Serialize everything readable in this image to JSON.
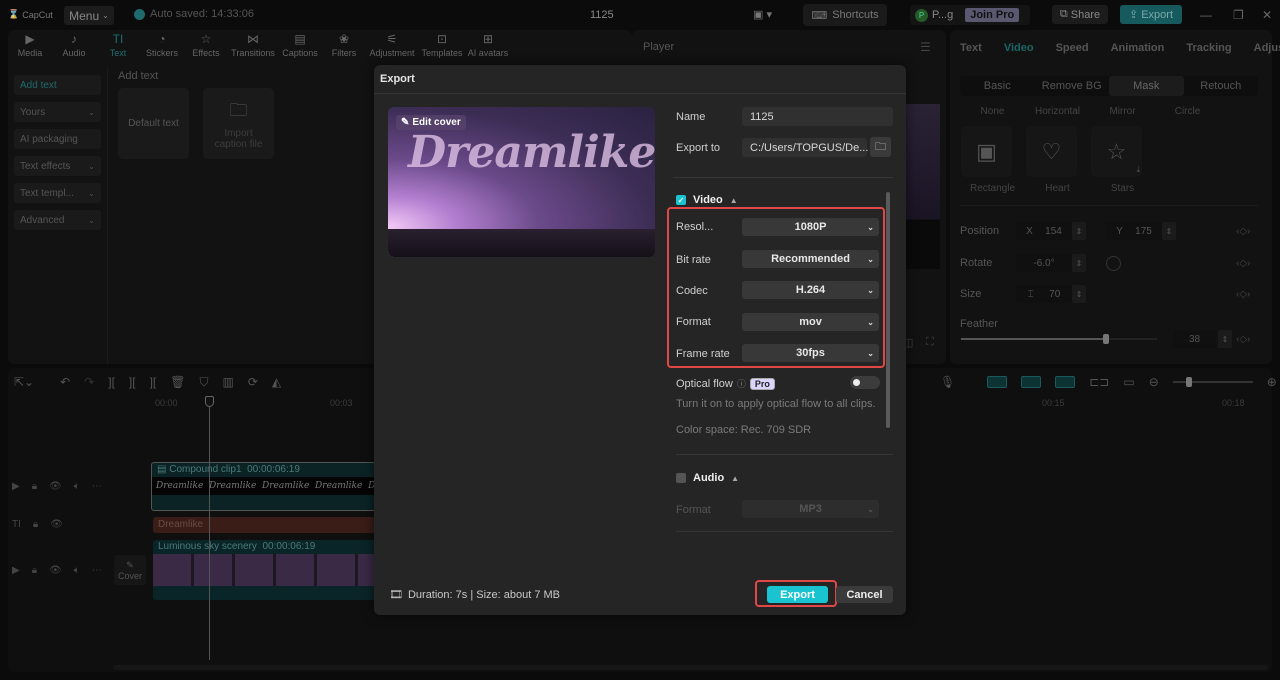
{
  "app": {
    "logo": "CapCut",
    "menu_label": "Menu",
    "autosave": "Auto saved: 14:33:06",
    "project_title": "1125",
    "shortcuts_label": "Shortcuts",
    "user_initial": "P",
    "user_name": "P...g",
    "join_pro": "Join Pro",
    "share_label": "Share",
    "export_label": "Export"
  },
  "toolbar": {
    "tools": [
      {
        "label": "Media",
        "icon": "media-icon"
      },
      {
        "label": "Audio",
        "icon": "audio-icon"
      },
      {
        "label": "Text",
        "icon": "text-icon",
        "active": true
      },
      {
        "label": "Stickers",
        "icon": "stickers-icon"
      },
      {
        "label": "Effects",
        "icon": "effects-icon"
      },
      {
        "label": "Transitions",
        "icon": "transitions-icon"
      },
      {
        "label": "Captions",
        "icon": "captions-icon"
      },
      {
        "label": "Filters",
        "icon": "filters-icon"
      },
      {
        "label": "Adjustment",
        "icon": "adjustment-icon"
      },
      {
        "label": "Templates",
        "icon": "templates-icon"
      },
      {
        "label": "AI avatars",
        "icon": "ai-avatars-icon"
      }
    ]
  },
  "sidebar": {
    "items": [
      {
        "label": "Add text",
        "active": true
      },
      {
        "label": "Yours",
        "chevron": true
      },
      {
        "label": "AI packaging"
      },
      {
        "label": "Text effects",
        "chevron": true
      },
      {
        "label": "Text templ...",
        "chevron": true
      },
      {
        "label": "Advanced",
        "chevron": true
      }
    ]
  },
  "text_panel": {
    "title": "Add text",
    "default_text": "Default text",
    "import_caption": "Import caption file"
  },
  "player": {
    "title": "Player"
  },
  "right_panel": {
    "tabs": [
      "Text",
      "Video",
      "Speed",
      "Animation",
      "Tracking",
      "Adjus"
    ],
    "active_tab": "Video",
    "subtabs": [
      "Basic",
      "Remove BG",
      "Mask",
      "Retouch"
    ],
    "active_subtab": "Mask",
    "mask_row1": [
      "None",
      "Horizontal",
      "Mirror",
      "Circle"
    ],
    "mask_row2": [
      "Rectangle",
      "Heart",
      "Stars"
    ],
    "position_label": "Position",
    "pos_x_label": "X",
    "pos_x": "154",
    "pos_y_label": "Y",
    "pos_y": "175",
    "rotate_label": "Rotate",
    "rotate": "-6.0°",
    "size_label": "Size",
    "size": "70",
    "feather_label": "Feather",
    "feather": "38",
    "feather_fraction": 0.38
  },
  "timeline": {
    "ruler": [
      "00:00",
      "00:03",
      "00:15",
      "00:18"
    ],
    "compound_clip": {
      "name": "Compound clip1",
      "duration": "00:00:06:19",
      "text_repeat": "Dreamlike"
    },
    "text_clip": "Dreamlike",
    "video_clip": {
      "name": "Luminous sky scenery",
      "duration": "00:00:06:19"
    },
    "cover_label": "Cover"
  },
  "dialog": {
    "title": "Export",
    "edit_cover": "Edit cover",
    "cover_text": "Dreamlike",
    "name_label": "Name",
    "name_value": "1125",
    "export_to_label": "Export to",
    "export_to_value": "C:/Users/TOPGUS/De...",
    "video": {
      "label": "Video",
      "checked": true,
      "rows": [
        {
          "label": "Resol...",
          "value": "1080P"
        },
        {
          "label": "Bit rate",
          "value": "Recommended"
        },
        {
          "label": "Codec",
          "value": "H.264"
        },
        {
          "label": "Format",
          "value": "mov"
        },
        {
          "label": "Frame rate",
          "value": "30fps"
        }
      ]
    },
    "optical_flow_label": "Optical flow",
    "pro_badge": "Pro",
    "optical_flow_on": false,
    "optical_flow_hint": "Turn it on to apply optical flow to all clips.",
    "color_space": "Color space: Rec. 709 SDR",
    "audio": {
      "label": "Audio",
      "checked": false,
      "format_label": "Format",
      "format_value": "MP3"
    },
    "footer_info": "Duration: 7s | Size: about 7  MB",
    "export_button": "Export",
    "cancel_button": "Cancel",
    "accent_color": "#19c3cf",
    "highlight_color": "#e04848"
  }
}
